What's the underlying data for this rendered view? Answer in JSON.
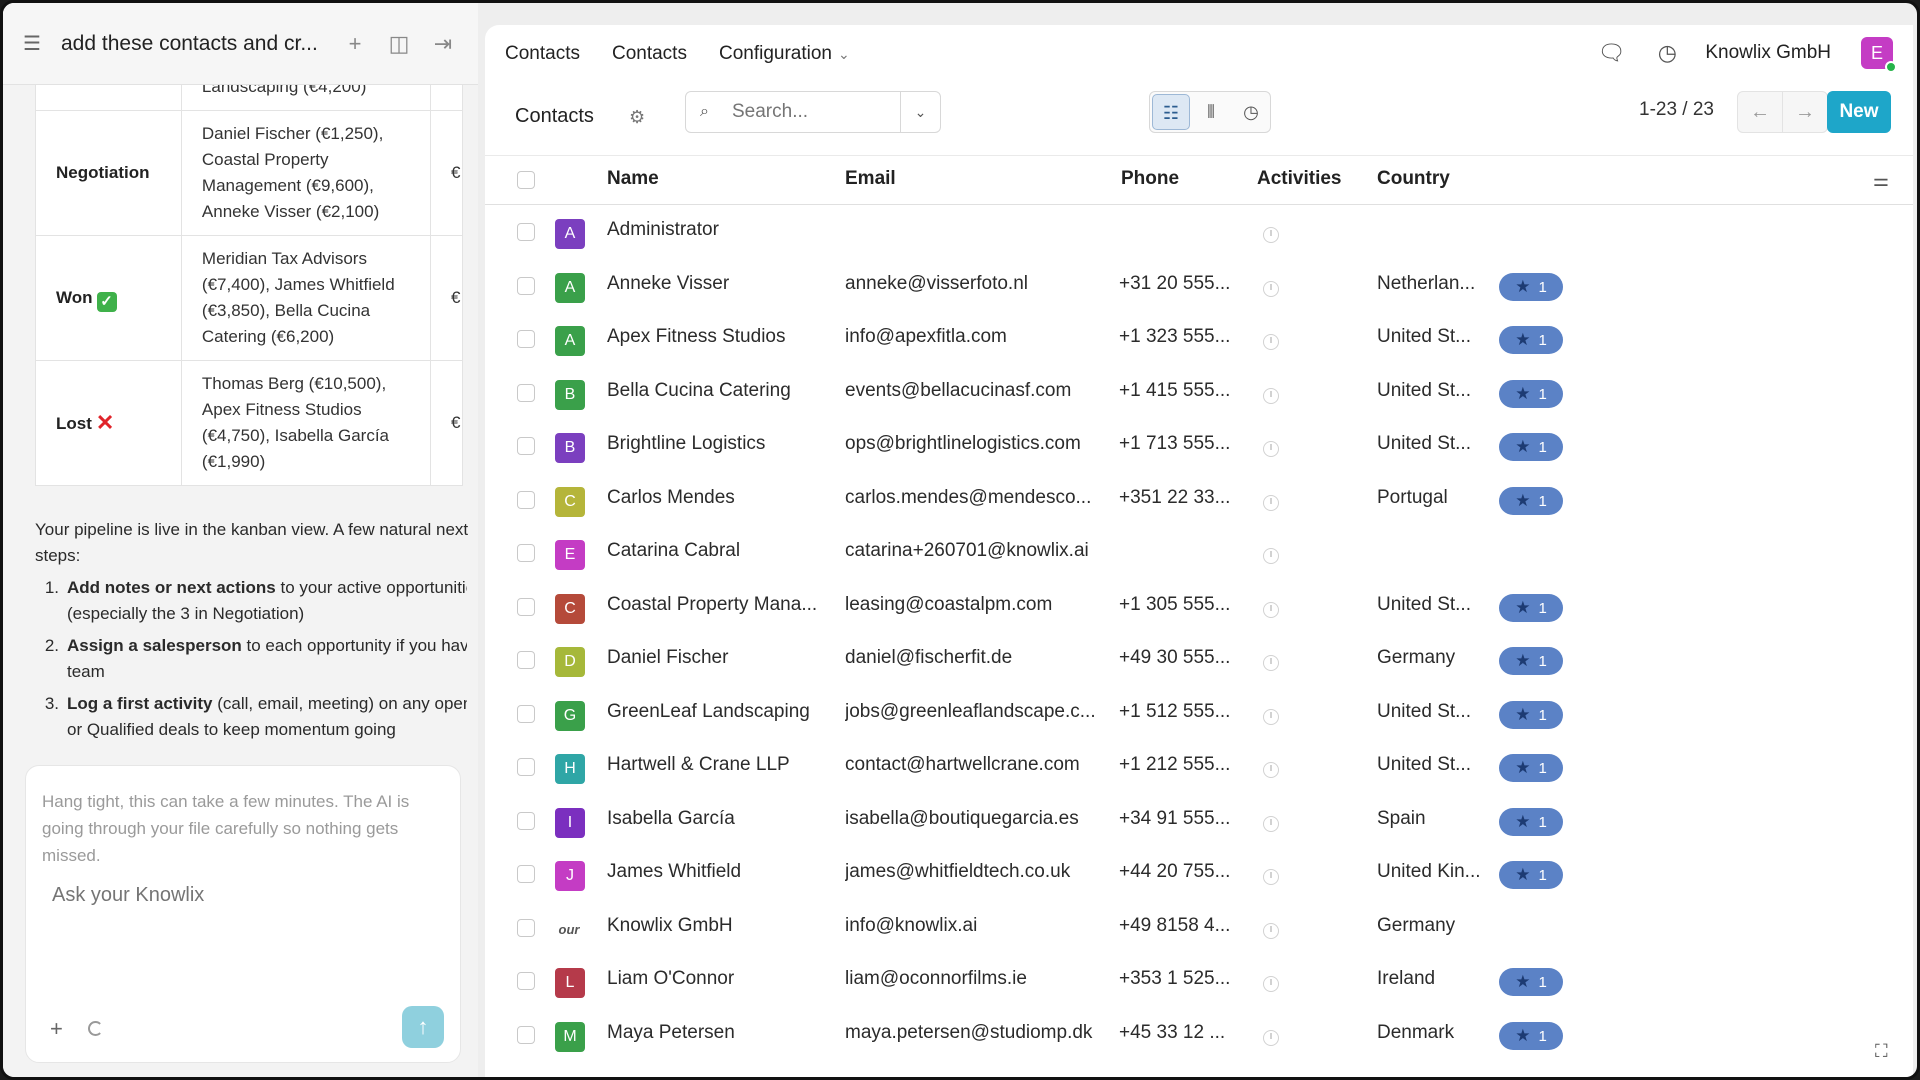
{
  "chat": {
    "title": "add these contacts and cr...",
    "pipeline": [
      {
        "stage": "",
        "deals": "Landscaping (€4,200)",
        "amount": ""
      },
      {
        "stage": "Negotiation",
        "deals": "Daniel Fischer (€1,250), Coastal Property Management (€9,600), Anneke Visser (€2,100)",
        "amount": "€"
      },
      {
        "stage": "Won",
        "stage_emoji": "✓",
        "deals": "Meridian Tax Advisors (€7,400), James Whitfield (€3,850), Bella Cucina Catering (€6,200)",
        "amount": "€"
      },
      {
        "stage": "Lost",
        "stage_emoji": "✕",
        "deals": "Thomas Berg (€10,500), Apex Fitness Studios (€4,750), Isabella García (€1,990)",
        "amount": "€"
      }
    ],
    "intro_line1": "Your pipeline is live in the kanban view. A few natural next",
    "intro_line2": "steps:",
    "steps": [
      {
        "num": "1.",
        "bold": "Add notes or next actions",
        "rest1": " to your active opportunities",
        "rest2": "(especially the 3 in Negotiation)"
      },
      {
        "num": "2.",
        "bold": "Assign a salesperson",
        "rest1": " to each opportunity if you have a",
        "rest2": "team"
      },
      {
        "num": "3.",
        "bold": "Log a first activity",
        "rest1": " (call, email, meeting) on any open",
        "rest2": "or Qualified deals to keep momentum going"
      }
    ],
    "hint": "Hang tight, this can take a few minutes. The AI is going through your file carefully so nothing gets missed.",
    "input_placeholder": "Ask your Knowlix"
  },
  "topbar": {
    "nav": [
      "Contacts",
      "Contacts",
      "Configuration"
    ],
    "company": "Knowlix GmbH",
    "avatar_letter": "E"
  },
  "control": {
    "title": "Contacts",
    "search_placeholder": "Search...",
    "pager": "1-23 / 23",
    "new_label": "New"
  },
  "columns": {
    "name": "Name",
    "email": "Email",
    "phone": "Phone",
    "activities": "Activities",
    "country": "Country"
  },
  "contacts": [
    {
      "initial": "A",
      "color": "#7b3fbf",
      "name": "Administrator",
      "email": "",
      "phone": "",
      "country": "",
      "tag": ""
    },
    {
      "initial": "A",
      "color": "#3aa04a",
      "name": "Anneke Visser",
      "email": "anneke@visserfoto.nl",
      "phone": "+31 20 555...",
      "country": "Netherlan...",
      "tag": "1"
    },
    {
      "initial": "A",
      "color": "#3aa04a",
      "name": "Apex Fitness Studios",
      "email": "info@apexfitla.com",
      "phone": "+1 323 555...",
      "country": "United St...",
      "tag": "1"
    },
    {
      "initial": "B",
      "color": "#3aa04a",
      "name": "Bella Cucina Catering",
      "email": "events@bellacucinasf.com",
      "phone": "+1 415 555...",
      "country": "United St...",
      "tag": "1"
    },
    {
      "initial": "B",
      "color": "#7b3fbf",
      "name": "Brightline Logistics",
      "email": "ops@brightlinelogistics.com",
      "phone": "+1 713 555...",
      "country": "United St...",
      "tag": "1"
    },
    {
      "initial": "C",
      "color": "#b5b53a",
      "name": "Carlos Mendes",
      "email": "carlos.mendes@mendesco...",
      "phone": "+351 22 33...",
      "country": "Portugal",
      "tag": "1"
    },
    {
      "initial": "E",
      "color": "#c43cc4",
      "name": "Catarina Cabral",
      "email": "catarina+260701@knowlix.ai",
      "phone": "",
      "country": "",
      "tag": ""
    },
    {
      "initial": "C",
      "color": "#b54a3a",
      "name": "Coastal Property Mana...",
      "email": "leasing@coastalpm.com",
      "phone": "+1 305 555...",
      "country": "United St...",
      "tag": "1"
    },
    {
      "initial": "D",
      "color": "#a6b83a",
      "name": "Daniel Fischer",
      "email": "daniel@fischerfit.de",
      "phone": "+49 30 555...",
      "country": "Germany",
      "tag": "1"
    },
    {
      "initial": "G",
      "color": "#3aa04a",
      "name": "GreenLeaf Landscaping",
      "email": "jobs@greenleaflandscape.c...",
      "phone": "+1 512 555...",
      "country": "United St...",
      "tag": "1"
    },
    {
      "initial": "H",
      "color": "#2fa6a6",
      "name": "Hartwell & Crane LLP",
      "email": "contact@hartwellcrane.com",
      "phone": "+1 212 555...",
      "country": "United St...",
      "tag": "1"
    },
    {
      "initial": "I",
      "color": "#7b2fbf",
      "name": "Isabella García",
      "email": "isabella@boutiquegarcia.es",
      "phone": "+34 91 555...",
      "country": "Spain",
      "tag": "1"
    },
    {
      "initial": "J",
      "color": "#c43cc4",
      "name": "James Whitfield",
      "email": "james@whitfieldtech.co.uk",
      "phone": "+44 20 755...",
      "country": "United Kin...",
      "tag": "1"
    },
    {
      "initial": "our",
      "color": "logo",
      "name": "Knowlix GmbH",
      "email": "info@knowlix.ai",
      "phone": "+49 8158 4...",
      "country": "Germany",
      "tag": ""
    },
    {
      "initial": "L",
      "color": "#b53a4a",
      "name": "Liam O'Connor",
      "email": "liam@oconnorfilms.ie",
      "phone": "+353 1 525...",
      "country": "Ireland",
      "tag": "1"
    },
    {
      "initial": "M",
      "color": "#3aa04a",
      "name": "Maya Petersen",
      "email": "maya.petersen@studiomp.dk",
      "phone": "+45 33 12 ...",
      "country": "Denmark",
      "tag": "1"
    }
  ]
}
